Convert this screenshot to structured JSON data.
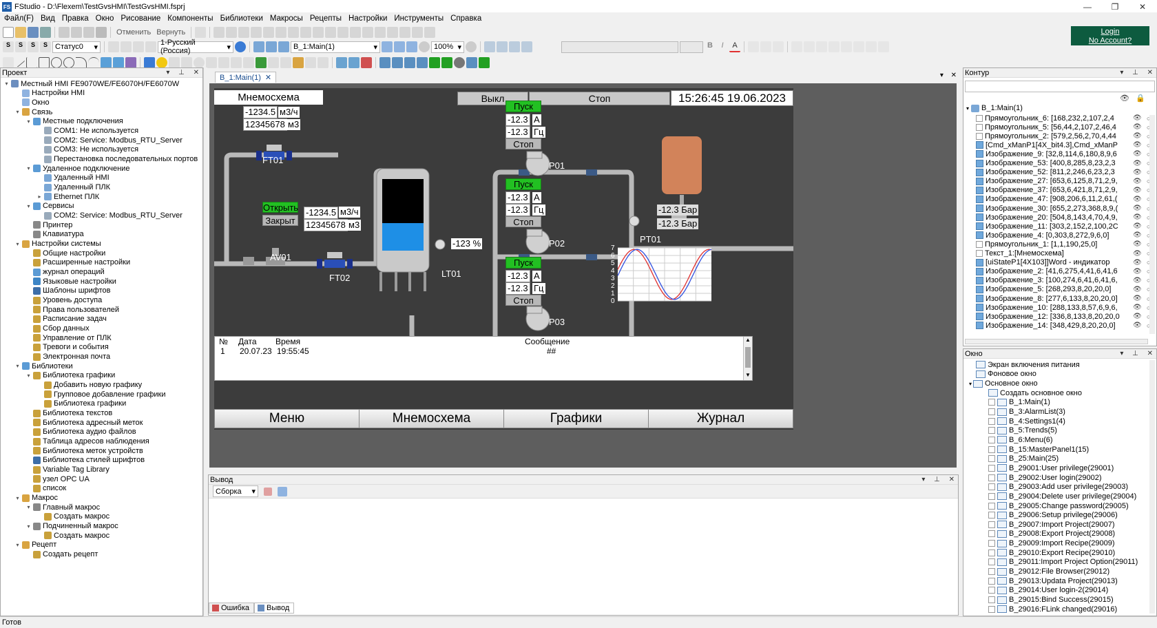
{
  "window": {
    "title": "FStudio - D:\\Flexem\\TestGvsHMI\\TestGvsHMI.fsprj",
    "app_badge": "FS"
  },
  "menu": [
    "Файл(F)",
    "Вид",
    "Правка",
    "Окно",
    "Рисование",
    "Компоненты",
    "Библиотеки",
    "Макросы",
    "Рецепты",
    "Настройки",
    "Инструменты",
    "Справка"
  ],
  "toolbar": {
    "undo": "Отменить",
    "redo": "Вернуть",
    "status_combo": "Статус0",
    "lang_combo": "1-Русский (Россия)",
    "screen_combo": "B_1:Main(1)",
    "zoom": "100%"
  },
  "login": {
    "line1": "Login",
    "line2": "No Account?"
  },
  "project_panel": {
    "title": "Проект",
    "tree": [
      {
        "label": "Местный HMI FE9070WE/FE6070H/FE6070W",
        "level": 0,
        "exp": "▾",
        "color": "#6c8ebf"
      },
      {
        "label": "Настройки HMI",
        "level": 1,
        "exp": "",
        "color": "#8fb3e0"
      },
      {
        "label": "Окно",
        "level": 1,
        "exp": "",
        "color": "#8fb3e0"
      },
      {
        "label": "Связь",
        "level": 1,
        "exp": "▾",
        "color": "#d9a441"
      },
      {
        "label": "Местные подключения",
        "level": 2,
        "exp": "▾",
        "color": "#5b9bd5"
      },
      {
        "label": "COM1: Не используется",
        "level": 3,
        "exp": "",
        "color": "#9ab"
      },
      {
        "label": "COM2: Service: Modbus_RTU_Server",
        "level": 3,
        "exp": "",
        "color": "#9ab"
      },
      {
        "label": "COM3: Не используется",
        "level": 3,
        "exp": "",
        "color": "#9ab"
      },
      {
        "label": "Перестановка последовательных портов",
        "level": 3,
        "exp": "",
        "color": "#9ab"
      },
      {
        "label": "Удаленное подключение",
        "level": 2,
        "exp": "▾",
        "color": "#5b9bd5"
      },
      {
        "label": "Удаленный HMI",
        "level": 3,
        "exp": "",
        "color": "#7aa7d6"
      },
      {
        "label": "Удаленный ПЛК",
        "level": 3,
        "exp": "",
        "color": "#7aa7d6"
      },
      {
        "label": "Ethernet ПЛК",
        "level": 3,
        "exp": "▸",
        "color": "#7aa7d6"
      },
      {
        "label": "Сервисы",
        "level": 2,
        "exp": "▾",
        "color": "#5b9bd5"
      },
      {
        "label": "COM2: Service: Modbus_RTU_Server",
        "level": 3,
        "exp": "",
        "color": "#9ab"
      },
      {
        "label": "Принтер",
        "level": 2,
        "exp": "",
        "color": "#888"
      },
      {
        "label": "Клавиатура",
        "level": 2,
        "exp": "",
        "color": "#888"
      },
      {
        "label": "Настройки системы",
        "level": 1,
        "exp": "▾",
        "color": "#d9a441"
      },
      {
        "label": "Общие настройки",
        "level": 2,
        "exp": "",
        "color": "#c9a13b"
      },
      {
        "label": "Расширенные настройки",
        "level": 2,
        "exp": "",
        "color": "#c9a13b"
      },
      {
        "label": "журнал операций",
        "level": 2,
        "exp": "",
        "color": "#5b9bd5"
      },
      {
        "label": "Языковые настройки",
        "level": 2,
        "exp": "",
        "color": "#3d85c6"
      },
      {
        "label": "Шаблоны шрифтов",
        "level": 2,
        "exp": "",
        "color": "#3d6ea8"
      },
      {
        "label": "Уровень доступа",
        "level": 2,
        "exp": "",
        "color": "#c9a13b"
      },
      {
        "label": "Права пользователей",
        "level": 2,
        "exp": "",
        "color": "#c9a13b"
      },
      {
        "label": "Расписание задач",
        "level": 2,
        "exp": "",
        "color": "#c9a13b"
      },
      {
        "label": "Сбор данных",
        "level": 2,
        "exp": "",
        "color": "#c9a13b"
      },
      {
        "label": "Управление от ПЛК",
        "level": 2,
        "exp": "",
        "color": "#c9a13b"
      },
      {
        "label": "Тревоги и события",
        "level": 2,
        "exp": "",
        "color": "#c9a13b"
      },
      {
        "label": "Электронная почта",
        "level": 2,
        "exp": "",
        "color": "#c9a13b"
      },
      {
        "label": "Библиотеки",
        "level": 1,
        "exp": "▾",
        "color": "#5b9bd5"
      },
      {
        "label": "Библиотека графики",
        "level": 2,
        "exp": "▾",
        "color": "#c9a13b"
      },
      {
        "label": "Добавить новую графику",
        "level": 3,
        "exp": "",
        "color": "#c9a13b"
      },
      {
        "label": "Групповое добавление графики",
        "level": 3,
        "exp": "",
        "color": "#c9a13b"
      },
      {
        "label": "Библиотека графики",
        "level": 3,
        "exp": "",
        "color": "#c9a13b"
      },
      {
        "label": "Библиотека текстов",
        "level": 2,
        "exp": "",
        "color": "#c9a13b"
      },
      {
        "label": "Библиотека адресный меток",
        "level": 2,
        "exp": "",
        "color": "#c9a13b"
      },
      {
        "label": "Библиотека аудио файлов",
        "level": 2,
        "exp": "",
        "color": "#c9a13b"
      },
      {
        "label": "Таблица адресов наблюдения",
        "level": 2,
        "exp": "",
        "color": "#c9a13b"
      },
      {
        "label": "Библиотека меток устройств",
        "level": 2,
        "exp": "",
        "color": "#c9a13b"
      },
      {
        "label": "Библиотека стилей шрифтов",
        "level": 2,
        "exp": "",
        "color": "#3d6ea8"
      },
      {
        "label": "Variable Tag Library",
        "level": 2,
        "exp": "",
        "color": "#c9a13b"
      },
      {
        "label": "узел OPC UA",
        "level": 2,
        "exp": "",
        "color": "#c9a13b"
      },
      {
        "label": "список",
        "level": 2,
        "exp": "",
        "color": "#c9a13b"
      },
      {
        "label": "Макрос",
        "level": 1,
        "exp": "▾",
        "color": "#d9a441"
      },
      {
        "label": "Главный макрос",
        "level": 2,
        "exp": "▾",
        "color": "#888"
      },
      {
        "label": "Создать макрос",
        "level": 3,
        "exp": "",
        "color": "#c9a13b"
      },
      {
        "label": "Подчиненный макрос",
        "level": 2,
        "exp": "▾",
        "color": "#888"
      },
      {
        "label": "Создать макрос",
        "level": 3,
        "exp": "",
        "color": "#c9a13b"
      },
      {
        "label": "Рецепт",
        "level": 1,
        "exp": "▾",
        "color": "#d9a441"
      },
      {
        "label": "Создать рецепт",
        "level": 2,
        "exp": "",
        "color": "#c9a13b"
      }
    ]
  },
  "editor_tab": "B_1:Main(1)",
  "hmi": {
    "header_title": "Мнемосхема",
    "btn_off": "Выкл",
    "btn_stop": "Стоп",
    "datetime": "15:26:45  19.06.2023",
    "ft01": {
      "flow": "-1234.5",
      "flow_unit": "м3/ч",
      "total": "12345678",
      "total_unit": "м3",
      "label": "FT01"
    },
    "ft02": {
      "flow": "-1234.5",
      "flow_unit": "м3/ч",
      "total": "12345678",
      "total_unit": "м3",
      "label": "FT02"
    },
    "av01": {
      "open": "Открыть",
      "close": "Закрыт",
      "label": "AV01"
    },
    "lt01": {
      "value": "-123 %",
      "label": "LT01"
    },
    "pumps": [
      {
        "start": "Пуск",
        "current": "-12.3",
        "current_unit": "А",
        "freq": "-12.3",
        "freq_unit": "Гц",
        "stop": "Стоп",
        "label": "P01"
      },
      {
        "start": "Пуск",
        "current": "-12.3",
        "current_unit": "А",
        "freq": "-12.3",
        "freq_unit": "Гц",
        "stop": "Стоп",
        "label": "P02"
      },
      {
        "start": "Пуск",
        "current": "-12.3",
        "current_unit": "А",
        "freq": "-12.3",
        "freq_unit": "Гц",
        "stop": "Стоп",
        "label": "P03"
      }
    ],
    "pt01": {
      "val1": "-12.3 Бар",
      "val2": "-12.3 Бар",
      "label": "PT01"
    },
    "trend_y_ticks": [
      "7",
      "6",
      "5",
      "4",
      "3",
      "2",
      "1",
      "0"
    ],
    "alarm_headers": [
      "№",
      "Дата",
      "Время",
      "Сообщение"
    ],
    "alarm_rows": [
      [
        "1",
        "20.07.23",
        "19:55:45",
        "##"
      ]
    ],
    "nav": [
      "Меню",
      "Мнемосхема",
      "Графики",
      "Журнал"
    ]
  },
  "output_panel": {
    "title": "Вывод",
    "combo": "Сборка",
    "tabs": [
      "Ошибка",
      "Вывод"
    ]
  },
  "contour_panel": {
    "title": "Контур",
    "root": "B_1:Main(1)",
    "items": [
      "Прямоугольник_6: [168,232,2,107,2,4",
      "Прямоугольник_5: [56,44,2,107,2,46,4",
      "Прямоугольник_2: [579,2,56,2,70,4,44",
      "[Cmd_xManP1[4X_bit4.3],Cmd_xManP",
      "Изображение_9: [32,8,114,6,180,8,9,6",
      "Изображение_53: [400,8,285,8,23,2,3",
      "Изображение_52: [811,2,246,6,23,2,3",
      "Изображение_27: [653,6,125,8,71,2,9,",
      "Изображение_37: [653,6,421,8,71,2,9,",
      "Изображение_47: [908,206,6,11,2,61,(",
      "Изображение_30: [655,2,273,368,8,9,(",
      "Изображение_20: [504,8,143,4,70,4,9,",
      "Изображение_11: [303,2,152,2,100,2C",
      "Изображение_4: [0,303,8,272,9,6,0]",
      "Прямоугольник_1: [1,1,190,25,0]",
      "Текст_1:[Мнемосхема]",
      "[uiStateP1[4X103]]Word - индикатор",
      "Изображение_2: [41,6,275,4,41,6,41,6",
      "Изображение_3: [100,274,6,41,6,41,6,",
      "Изображение_5: [268,293,8,20,20,0]",
      "Изображение_8: [277,6,133,8,20,20,0]",
      "Изображение_10: [288,133,8,57,6,9,6,",
      "Изображение_12: [336,8,133,8,20,20,0",
      "Изображение_14: [348,429,8,20,20,0]"
    ]
  },
  "window_panel": {
    "title": "Окно",
    "items": [
      {
        "label": "Экран включения питания",
        "level": 1
      },
      {
        "label": "Фоновое окно",
        "level": 1
      },
      {
        "label": "Основное окно",
        "level": 1
      },
      {
        "label": "Создать основное окно",
        "level": 2
      },
      {
        "label": "B_1:Main(1)",
        "level": 2
      },
      {
        "label": "B_3:AlarmList(3)",
        "level": 2
      },
      {
        "label": "B_4:Settings1(4)",
        "level": 2
      },
      {
        "label": "B_5:Trends(5)",
        "level": 2
      },
      {
        "label": "B_6:Menu(6)",
        "level": 2
      },
      {
        "label": "B_15:MasterPanel1(15)",
        "level": 2
      },
      {
        "label": "B_25:Main(25)",
        "level": 2
      },
      {
        "label": "B_29001:User privilege(29001)",
        "level": 2
      },
      {
        "label": "B_29002:User login(29002)",
        "level": 2
      },
      {
        "label": "B_29003:Add user privilege(29003)",
        "level": 2
      },
      {
        "label": "B_29004:Delete user privilege(29004)",
        "level": 2
      },
      {
        "label": "B_29005:Change password(29005)",
        "level": 2
      },
      {
        "label": "B_29006:Setup privilege(29006)",
        "level": 2
      },
      {
        "label": "B_29007:Import Project(29007)",
        "level": 2
      },
      {
        "label": "B_29008:Export Project(29008)",
        "level": 2
      },
      {
        "label": "B_29009:Import Recipe(29009)",
        "level": 2
      },
      {
        "label": "B_29010:Export Recipe(29010)",
        "level": 2
      },
      {
        "label": "B_29011:Import Project Option(29011)",
        "level": 2
      },
      {
        "label": "B_29012:File Browser(29012)",
        "level": 2
      },
      {
        "label": "B_29013:Updata Project(29013)",
        "level": 2
      },
      {
        "label": "B_29014:User login-2(29014)",
        "level": 2
      },
      {
        "label": "B_29015:Bind Success(29015)",
        "level": 2
      },
      {
        "label": "B_29016:FLink changed(29016)",
        "level": 2
      }
    ]
  },
  "status_bar": "Готов",
  "colors": {
    "hmi_bg": "#3c3c3c",
    "canvas_bg": "#5e5e5e",
    "green_button": "#22c022",
    "login_bg": "#0d5b3f",
    "tank_water": "#1e8fe6",
    "trend_red": "#e03030",
    "trend_blue": "#3050e0"
  }
}
